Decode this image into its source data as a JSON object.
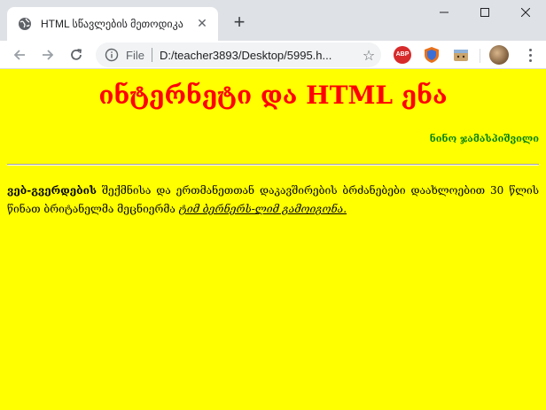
{
  "browser": {
    "tab_title": "HTML სწავლების მეთოდიკა",
    "new_tab_label": "+",
    "address_scheme": "File",
    "address_url": "D:/teacher3893/Desktop/5995.h...",
    "extensions": {
      "abp_label": "ABP"
    }
  },
  "page": {
    "title": "ინტერნეტი და HTML ენა",
    "author": "ნინო ჯამასპიშვილი",
    "paragraph": {
      "bold": "ვებ-გვერდების",
      "text": " შექმნისა და ერთმანეთთან დაკავშირების ბრძანებები დაახლოებით 30 წლის წინათ ბრიტანელმა მეცნიერმა ",
      "italic": "ტიმ ბერნერს-ლიმ გამოიგონა."
    }
  },
  "colors": {
    "page_background": "#ffff00",
    "title": "#ff0000",
    "author": "#008000"
  }
}
